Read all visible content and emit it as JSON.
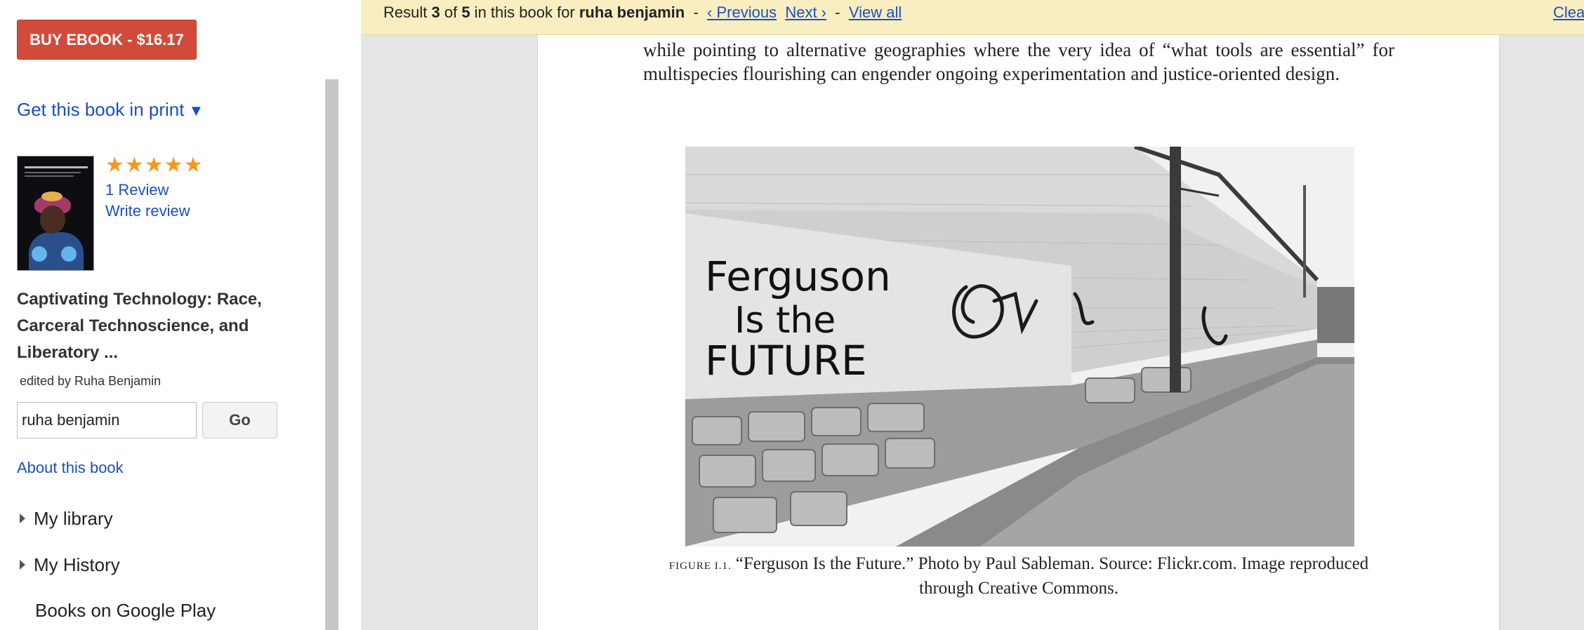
{
  "sidebar": {
    "buy_button": "BUY EBOOK - $16.17",
    "get_print": "Get this book in print",
    "get_print_arrow": "▼",
    "rating_stars": "★★★★★",
    "review_count": "1 Review",
    "write_review": "Write review",
    "book_title": "Captivating Technology: Race, Carceral Technoscience, and Liberatory ...",
    "editor": "edited by Ruha Benjamin",
    "search": {
      "value": "ruha benjamin",
      "go_label": "Go"
    },
    "about_book": "About this book",
    "nav": {
      "library": "My library",
      "history": "My History",
      "play": "Books on Google Play"
    }
  },
  "result_bar": {
    "prefix": "Result ",
    "current": "3",
    "of": " of ",
    "total": "5",
    "in_book": " in this book for ",
    "query": "ruha benjamin",
    "sep1": " - ",
    "previous": "‹ Previous",
    "next": "Next ›",
    "sep2": " - ",
    "view_all": "View all",
    "clear": "Clea"
  },
  "page": {
    "body_text": "while pointing to alternative geographies where the very idea of “what tools are essential” for multispecies flourishing can engender ongoing experimentation and justice-oriented design.",
    "photo_graffiti_text": "Ferguson Is the FUTURE",
    "figure_label": "FIGURE I.1.",
    "caption": "“Ferguson Is the Future.” Photo by Paul Sableman. Source: Flickr.com. Image reproduced through Creative Commons."
  },
  "colors": {
    "buy_button": "#d24b3a",
    "link": "#1a4fc4",
    "result_bar": "#f9eec0",
    "stars": "#f29a1f",
    "viewer_background": "#e5e5e5"
  },
  "icons": {
    "get_print_arrow": "triangle-down-icon",
    "nav_caret": "caret-right-icon",
    "rating": "star-icon"
  }
}
